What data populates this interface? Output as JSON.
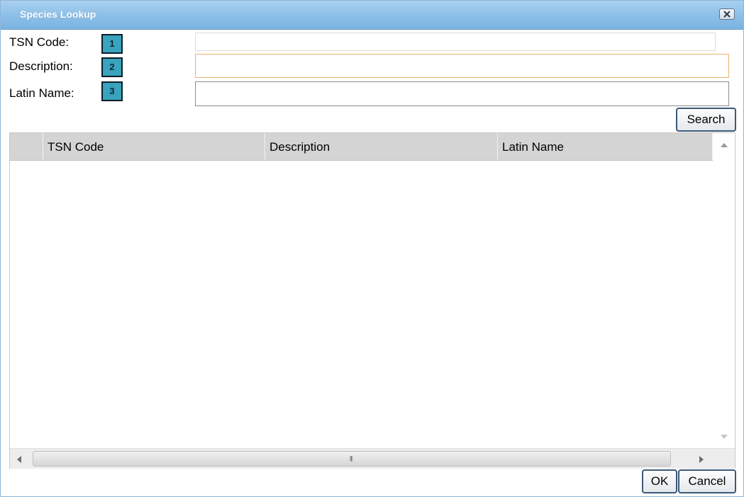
{
  "window": {
    "title": "Species Lookup"
  },
  "form": {
    "tsn_label": "TSN Code:",
    "description_label": "Description:",
    "latin_label": "Latin Name:",
    "badges": [
      "1",
      "2",
      "3"
    ],
    "tsn_value": "",
    "description_value": "",
    "latin_value": ""
  },
  "buttons": {
    "search": "Search",
    "ok": "OK",
    "cancel": "Cancel"
  },
  "grid": {
    "columns": [
      "",
      "TSN Code",
      "Description",
      "Latin Name"
    ],
    "rows": []
  },
  "colors": {
    "title_bar": "#8ec0e8",
    "badge": "#3aa3bd",
    "focus_border": "#e8b46a"
  }
}
